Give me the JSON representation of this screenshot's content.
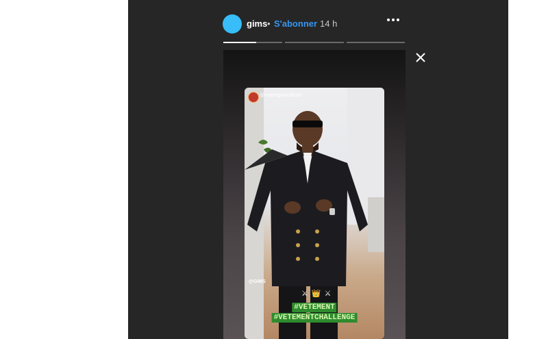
{
  "header": {
    "username": "gims",
    "separator": "•",
    "follow_label": "S'abonner",
    "timestamp": "14 h",
    "more_icon": "more-horizontal-icon",
    "close_icon": "close-icon"
  },
  "progress": {
    "segments": 3,
    "active_index": 0,
    "active_fraction": 0.55
  },
  "story": {
    "repost_username": "@maitregimsofficiel",
    "corner_tag": "@GIMS",
    "emoji_row": "⚔ 👑 ⚔",
    "hashtags": [
      "#VETEMENT",
      "#VETEMENTCHALLENGE"
    ]
  },
  "colors": {
    "viewer_bg": "#262626",
    "accent_blue": "#3797f0",
    "avatar_ring": "#38bdf8",
    "hashtag_bg": "#2e8b2e"
  }
}
